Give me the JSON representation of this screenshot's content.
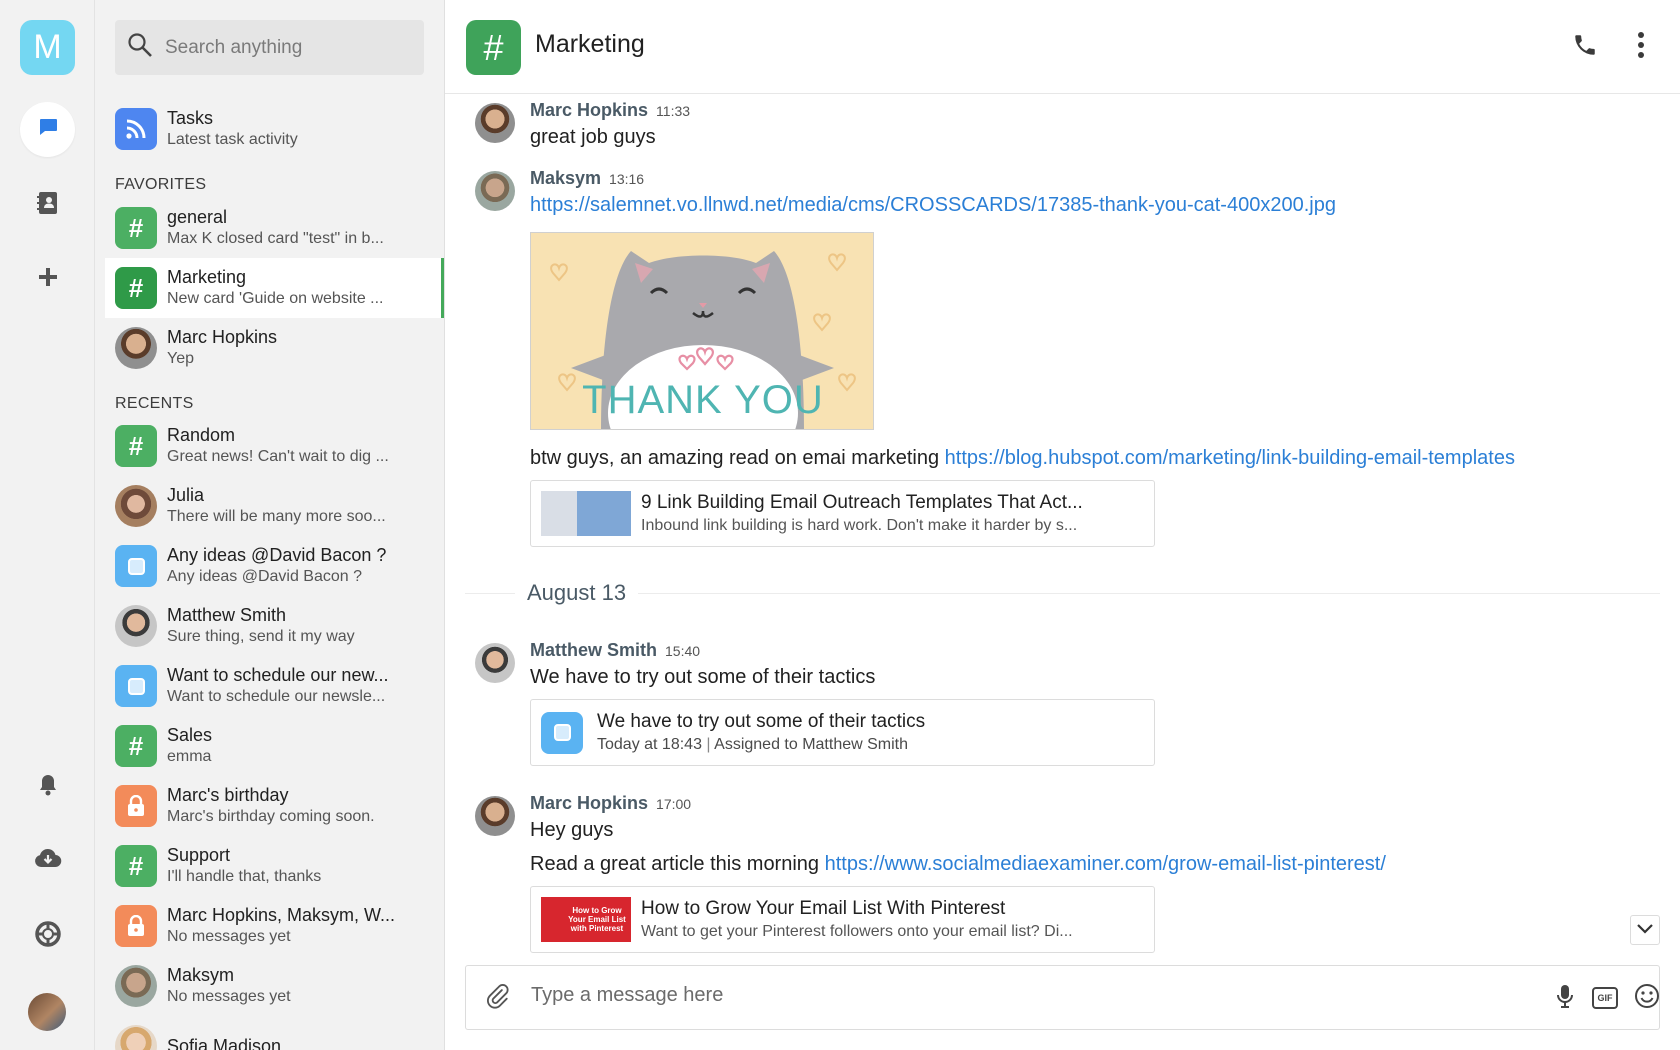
{
  "app": {
    "logo_letter": "M"
  },
  "search": {
    "placeholder": "Search anything"
  },
  "tasks_item": {
    "title": "Tasks",
    "subtitle": "Latest task activity"
  },
  "sections": {
    "favorites": "FAVORITES",
    "recents": "RECENTS"
  },
  "favorites": [
    {
      "title": "general",
      "subtitle": "Max K closed card \"test\" in b...",
      "icon": "hash-icon"
    },
    {
      "title": "Marketing",
      "subtitle": "New card 'Guide on website ...",
      "icon": "hash-icon"
    },
    {
      "title": "Marc Hopkins",
      "subtitle": "Yep",
      "icon": "avatar"
    }
  ],
  "recents": [
    {
      "title": "Random",
      "subtitle": "Great news! Can't wait to dig ...",
      "icon": "hash-icon"
    },
    {
      "title": "Julia",
      "subtitle": "There will be many more soo...",
      "icon": "avatar"
    },
    {
      "title": "Any ideas @David Bacon ?",
      "subtitle": "Any ideas @David Bacon ?",
      "icon": "task-icon"
    },
    {
      "title": "Matthew Smith",
      "subtitle": "Sure thing, send it my way",
      "icon": "avatar"
    },
    {
      "title": "Want to schedule our new...",
      "subtitle": "Want to schedule our newsle...",
      "icon": "task-icon"
    },
    {
      "title": "Sales",
      "subtitle": "emma",
      "icon": "hash-icon"
    },
    {
      "title": "Marc's birthday",
      "subtitle": "Marc's birthday coming soon.",
      "icon": "lock-icon"
    },
    {
      "title": "Support",
      "subtitle": "I'll handle that, thanks",
      "icon": "hash-icon"
    },
    {
      "title": "Marc Hopkins, Maksym, W...",
      "subtitle": "No messages yet",
      "icon": "lock-icon"
    },
    {
      "title": "Maksym",
      "subtitle": "No messages yet",
      "icon": "avatar"
    },
    {
      "title": "Sofia Madison",
      "subtitle": "",
      "icon": "avatar"
    }
  ],
  "channel": {
    "title": "Marketing"
  },
  "messages": [
    {
      "author": "Marc Hopkins",
      "time": "11:33",
      "text": "great job guys"
    },
    {
      "author": "Maksym",
      "time": "13:16",
      "link": "https://salemnet.vo.llnwd.net/media/cms/CROSSCARDS/17385-thank-you-cat-400x200.jpg",
      "image_text": "THANK YOU",
      "text": "btw guys, an amazing read on emai marketing ",
      "link2": "https://blog.hubspot.com/marketing/link-building-email-templates",
      "card": {
        "title": "9 Link Building Email Outreach Templates That Act...",
        "subtitle": "Inbound link building is hard work. Don't make it harder by s..."
      }
    },
    {
      "author": "Matthew Smith",
      "time": "15:40",
      "text": "We have to try out some of their tactics",
      "task": {
        "title": "We have to try out some of their tactics",
        "date": "Today at 18:43",
        "assigned_label": "Assigned to",
        "assignee": "Matthew Smith"
      }
    },
    {
      "author": "Marc Hopkins",
      "time": "17:00",
      "text": "Hey guys",
      "text2": "Read a great article this morning ",
      "link": "https://www.socialmediaexaminer.com/grow-email-list-pinterest/",
      "card": {
        "title": "How to Grow Your Email List With Pinterest",
        "subtitle": "Want to get your Pinterest followers onto your email list? Di...",
        "thumb_text": "How to Grow Your Email List with Pinterest"
      }
    }
  ],
  "date_separator": "August 13",
  "composer": {
    "placeholder": "Type a message here",
    "gif_label": "GIF"
  },
  "colors": {
    "accent_green": "#44a95a",
    "link_blue": "#2b7fd6",
    "logo_cyan": "#74d7f2"
  }
}
